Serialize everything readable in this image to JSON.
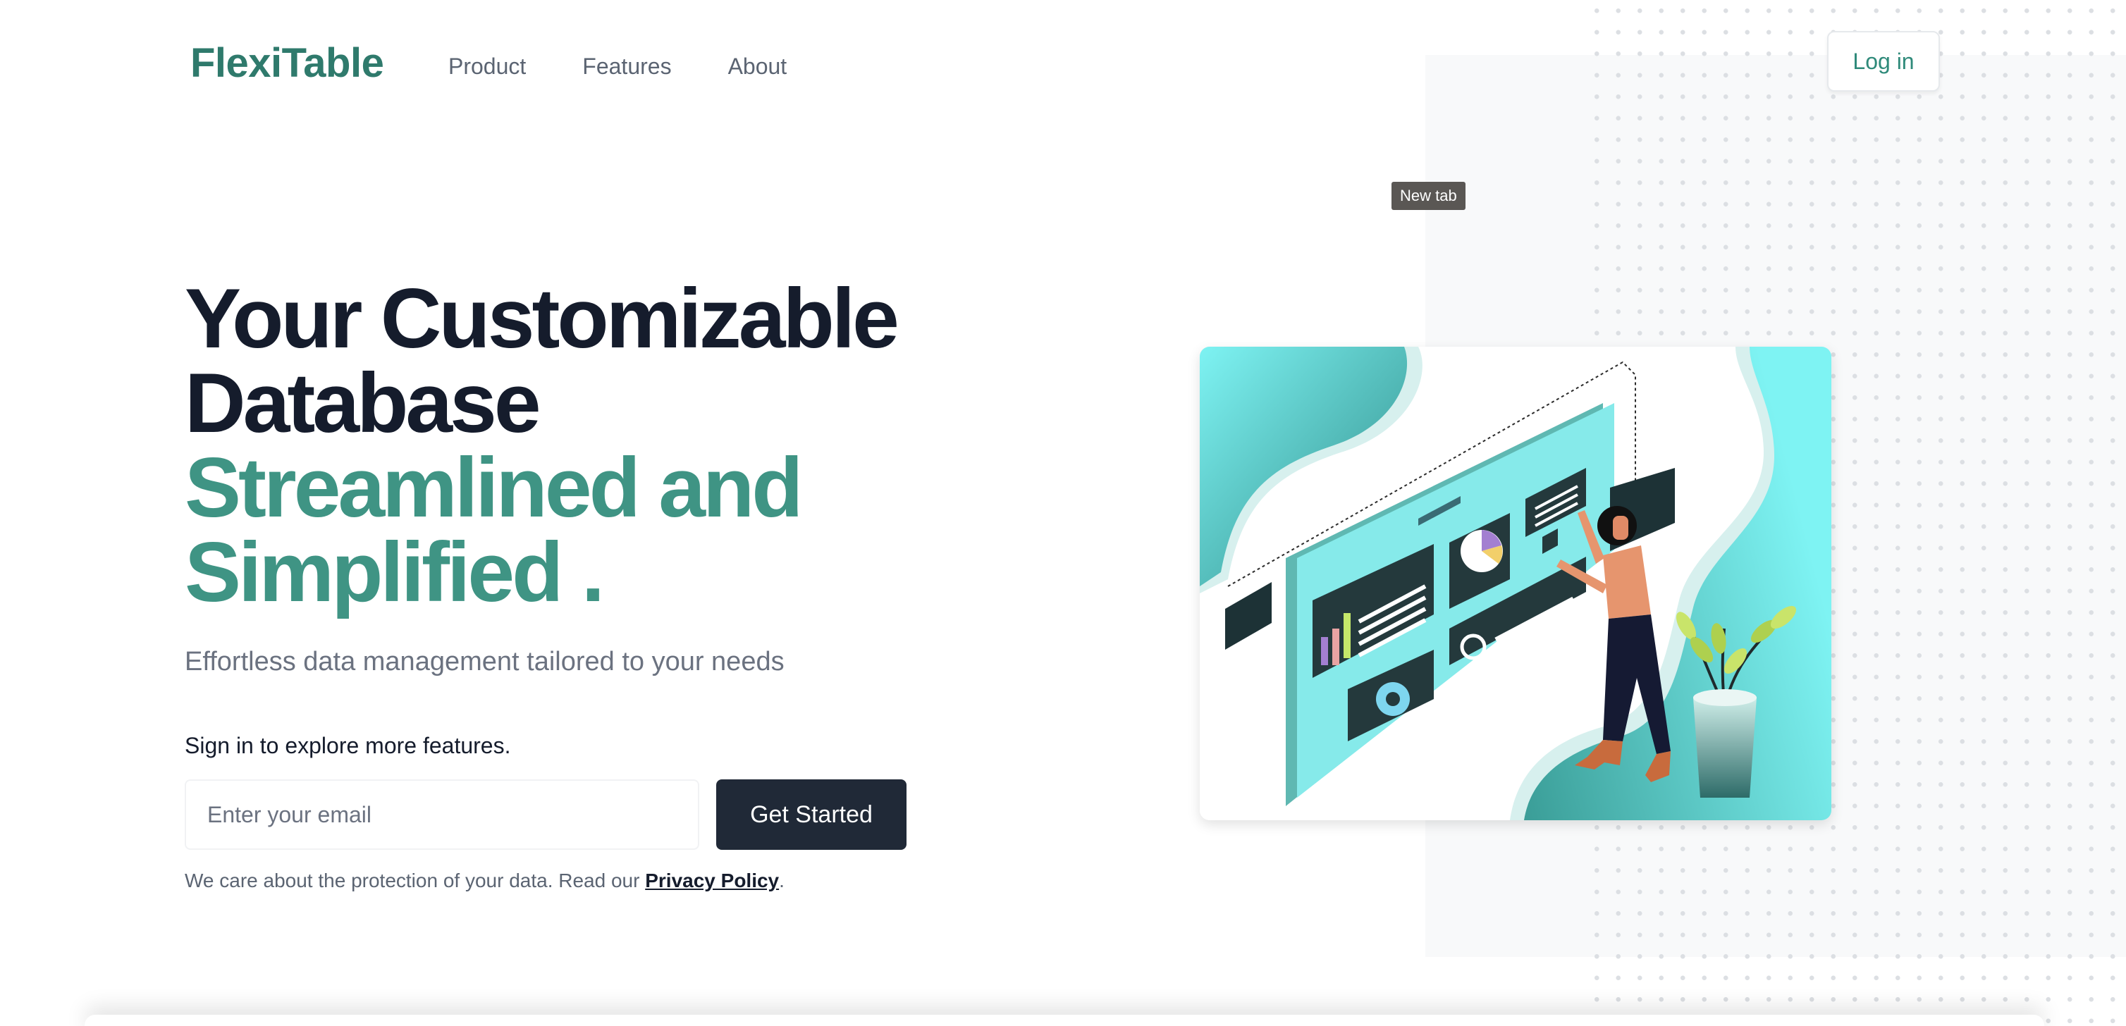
{
  "brand": {
    "name": "FlexiTable",
    "color": "#2f7a6c"
  },
  "nav": {
    "items": [
      {
        "label": "Product"
      },
      {
        "label": "Features"
      },
      {
        "label": "About"
      }
    ],
    "login_label": "Log in"
  },
  "tooltip": {
    "text": "New tab"
  },
  "hero": {
    "headline_line1": "Your Customizable",
    "headline_line2": "Database",
    "headline_accent_line1": "Streamlined and",
    "headline_accent_line2": "Simplified .",
    "subtitle": "Effortless data management tailored to your needs",
    "signin_label": "Sign in to explore more features.",
    "email_placeholder": "Enter your email",
    "email_value": "",
    "cta_label": "Get Started",
    "privacy_prefix": "We care about the protection of your data. Read our ",
    "privacy_link": "Privacy Policy",
    "privacy_suffix": "."
  },
  "colors": {
    "dark_text": "#151c2c",
    "accent_text": "#3f9484",
    "button_dark": "#202937",
    "teal": "#4fb8b0",
    "cyan": "#7ef3f3"
  },
  "illustration": {
    "icon": "database-dashboard-illustration"
  }
}
